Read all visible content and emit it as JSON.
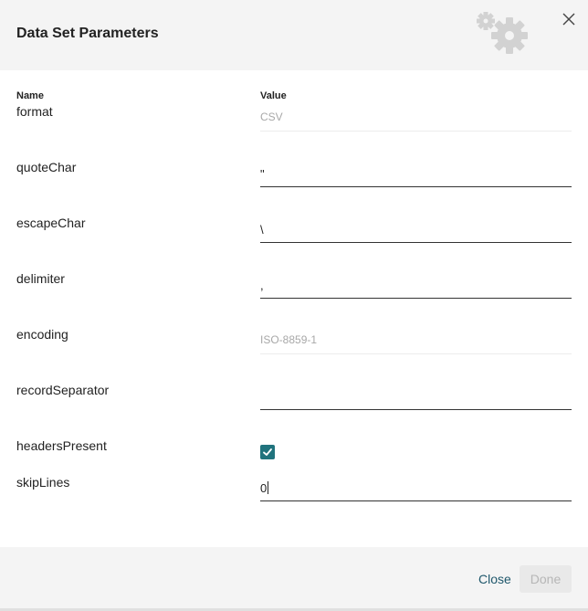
{
  "dialog": {
    "title": "Data Set Parameters",
    "header_icon": "gears-icon",
    "close_icon": "close-icon"
  },
  "columns": {
    "name": "Name",
    "value": "Value"
  },
  "params": {
    "format": {
      "label": "format",
      "value": "CSV"
    },
    "quoteChar": {
      "label": "quoteChar",
      "value": "\""
    },
    "escapeChar": {
      "label": "escapeChar",
      "value": "\\"
    },
    "delimiter": {
      "label": "delimiter",
      "value": ","
    },
    "encoding": {
      "label": "encoding",
      "value": "ISO-8859-1"
    },
    "recordSeparator": {
      "label": "recordSeparator",
      "value": ""
    },
    "headersPresent": {
      "label": "headersPresent",
      "checked": true
    },
    "skipLines": {
      "label": "skipLines",
      "value": "0"
    }
  },
  "footer": {
    "close_label": "Close",
    "done_label": "Done"
  },
  "colors": {
    "accent": "#20737d",
    "link": "#20586c",
    "header_bg": "#f4f4f4"
  }
}
